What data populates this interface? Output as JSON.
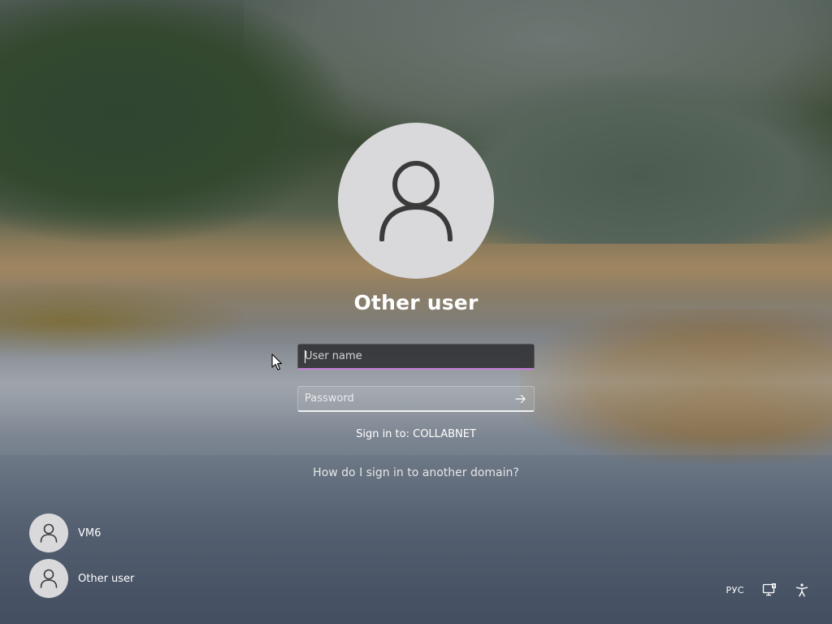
{
  "login": {
    "display_name": "Other user",
    "username_placeholder": "User name",
    "username_value": "",
    "password_placeholder": "Password",
    "password_value": "",
    "sign_in_to": "Sign in to: COLLABNET",
    "other_domain_link": "How do I sign in to another domain?",
    "username_focus_color": "#c77dd8"
  },
  "user_list": [
    {
      "label": "VM6",
      "icon": "user-icon"
    },
    {
      "label": "Other user",
      "icon": "user-icon"
    }
  ],
  "tray": {
    "language": "РУС",
    "network_icon": "network-icon",
    "accessibility_icon": "accessibility-icon"
  }
}
